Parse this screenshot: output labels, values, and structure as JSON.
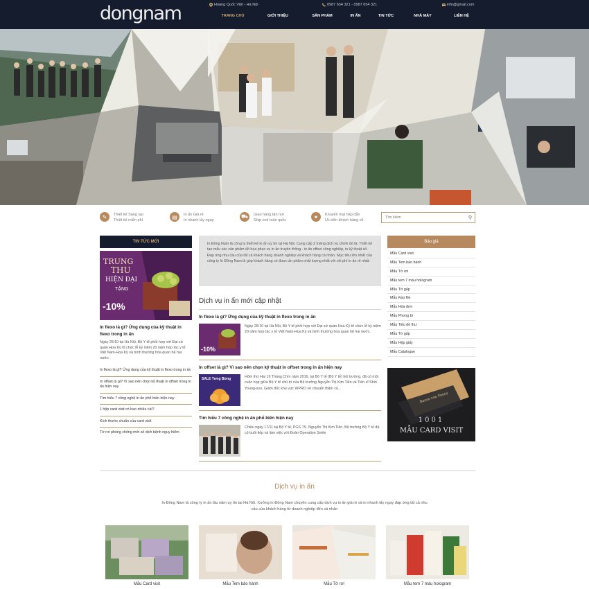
{
  "header": {
    "logo": "dongnam",
    "address": "Hoàng Quốc Việt - Hà Nội",
    "phones": "0987 654 321 - 0987 654 321",
    "email": "info@gmail.com",
    "nav": [
      "TRANG CHỦ",
      "GIỚI THIỆU",
      "SẢN PHẨM",
      "IN ẤN",
      "TIN TỨC",
      "NHÀ MÁY",
      "LIÊN HỆ"
    ],
    "active_nav": 0
  },
  "features": [
    {
      "icon": "pencil-icon",
      "title": "Thiết kế Sáng tạo",
      "sub": "Thiết kế miễn phí"
    },
    {
      "icon": "printer-icon",
      "title": "In ấn Giá rẻ",
      "sub": "In nhanh lấy ngay"
    },
    {
      "icon": "truck-icon",
      "title": "Giao hàng tận nơi",
      "sub": "Ship cod toàn quốc"
    },
    {
      "icon": "gift-icon",
      "title": "Khuyến mại hấp dẫn",
      "sub": "Ưu tiên khách hàng cũ"
    }
  ],
  "search": {
    "placeholder": "Tìm kiếm"
  },
  "left": {
    "heading": "TIN TỨC MỚI",
    "banner": {
      "line1": "TRUNG",
      "line2": "THU",
      "line3": "HIỆN ĐẠI",
      "line4": "TẶNG",
      "line5": "-10%"
    },
    "article_title": "In flexo là gì? Ứng dụng của kỹ thuật in flexo trong in ấn",
    "article_desc": "Ngày 25/10 tại Hà Nội, Bộ Y tế phối hợp với Đại sứ quán Hoa Kỳ tổ chức lễ kỷ niệm 20 năm hợp tác y tế Việt Nam-Hoa Kỳ và bình thường hóa quan hệ hai nước.",
    "links": [
      "In flexo là gì? Ứng dụng của kỹ thuật in flexo trong in ấn",
      "In offset là gì? Vì sao nên chọn kỹ thuật in offset trong in ấn hiện nay",
      "Tìm hiểu 7 công nghệ in ấn phổ biến hiện nay",
      "1 hộp card visit có bao nhiêu cái?",
      "Kích thước chuẩn của card visit",
      "Tờ rơi phòng chống mới số dịch bệnh nguy hiểm"
    ]
  },
  "center": {
    "intro": "In Đông Nam là công ty thiết kế in ấn uy tín tại Hà Nội. Cung cấp 2 mảng dịch vụ chính đó là: Thiết kế tạo mẫu các sản phẩm đồ họa phục vụ in ấn truyền thông - in ấn offset công nghiệp, in kỹ thuật số. Đáp ứng nhu cầu của tất cả khách hàng doanh nghiệp và khách hàng cá nhân. Mục tiêu lớn nhất của công ty In Đông Nam là góp khách hàng có được ấn phẩm chất lượng nhất với chi phí in ấn rẻ nhất.",
    "section_title": "Dịch vụ in ấn mới cập nhật",
    "posts": [
      {
        "title": "In flexo là gì? Ứng dụng của kỹ thuật in flexo trong in ấn",
        "desc": "Ngày 25/10 tại Hà Nội, Bộ Y tế phối hợp với Đại sứ quán Hoa Kỳ tổ chức lễ kỷ niệm 20 năm hợp tác y tế Việt Nam-Hoa Kỳ và bình thường hóa quan hệ hai nước."
      },
      {
        "title": "In offset là gì? Vì sao nên chọn kỹ thuật in offset trong in ấn hiện nay",
        "desc": "Hôm thứ Hai 19 Tháng Chín năm 2016, tại Bộ Y tế (Bộ Y tế) hội trường, đã có một cuộc họp giữa Bộ Y tế chủ trì của Bộ trưởng Nguyễn Thị Kim Tiến và Tiến sĩ Shin Young-soo, Giám đốc khu vực WPRO về chuyến thăm củ..."
      },
      {
        "title": "Tìm hiểu 7 công nghệ in ấn phổ biến hiện nay",
        "desc": "Chiều ngày 17/11 tại Bộ Y tế, PGS.TS. Nguyễn Thị Kim Tiến, Bộ trưởng Bộ Y tế đã có buổi tiếp và làm việc với Đoàn Operation Smile"
      }
    ],
    "thumb2_badge": "SALE Tưng Bừng"
  },
  "right": {
    "heading": "Báo giá",
    "links": [
      "Mẫu Card visit",
      "Mẫu Tem bảo hành",
      "Mẫu Tờ rơi",
      "Mẫu tem 7 màu hologram",
      "Mẫu Tờ gấp",
      "Mẫu Kẹp file",
      "Mẫu Hóa đơn",
      "Mẫu Phong bì",
      "Mẫu Tiêu đề thư",
      "Mẫu Tờ gấp",
      "Mẫu Hộp giấy",
      "Mẫu Catalogue"
    ],
    "banner_top": "1001",
    "banner_bottom": "MẪU CARD VISIT",
    "card_text": "Baron von Fancy"
  },
  "services": {
    "title": "Dịch vụ in ấn",
    "desc": "In Đông Nam là công ty in ấn lâu năm uy tín tại Hà Nội. Xưởng in Đông Nam chuyên cung cấp dịch vụ in ấn giá rẻ và in nhanh lấy ngay đáp ứng tất cả nhu cầu của khách hàng từ doanh nghiệp đến cá nhân",
    "items": [
      "Mẫu Card visit",
      "Mẫu Tem bảo hành",
      "Mẫu Tờ rơi",
      "Mẫu tem 7 màu hologram"
    ]
  }
}
